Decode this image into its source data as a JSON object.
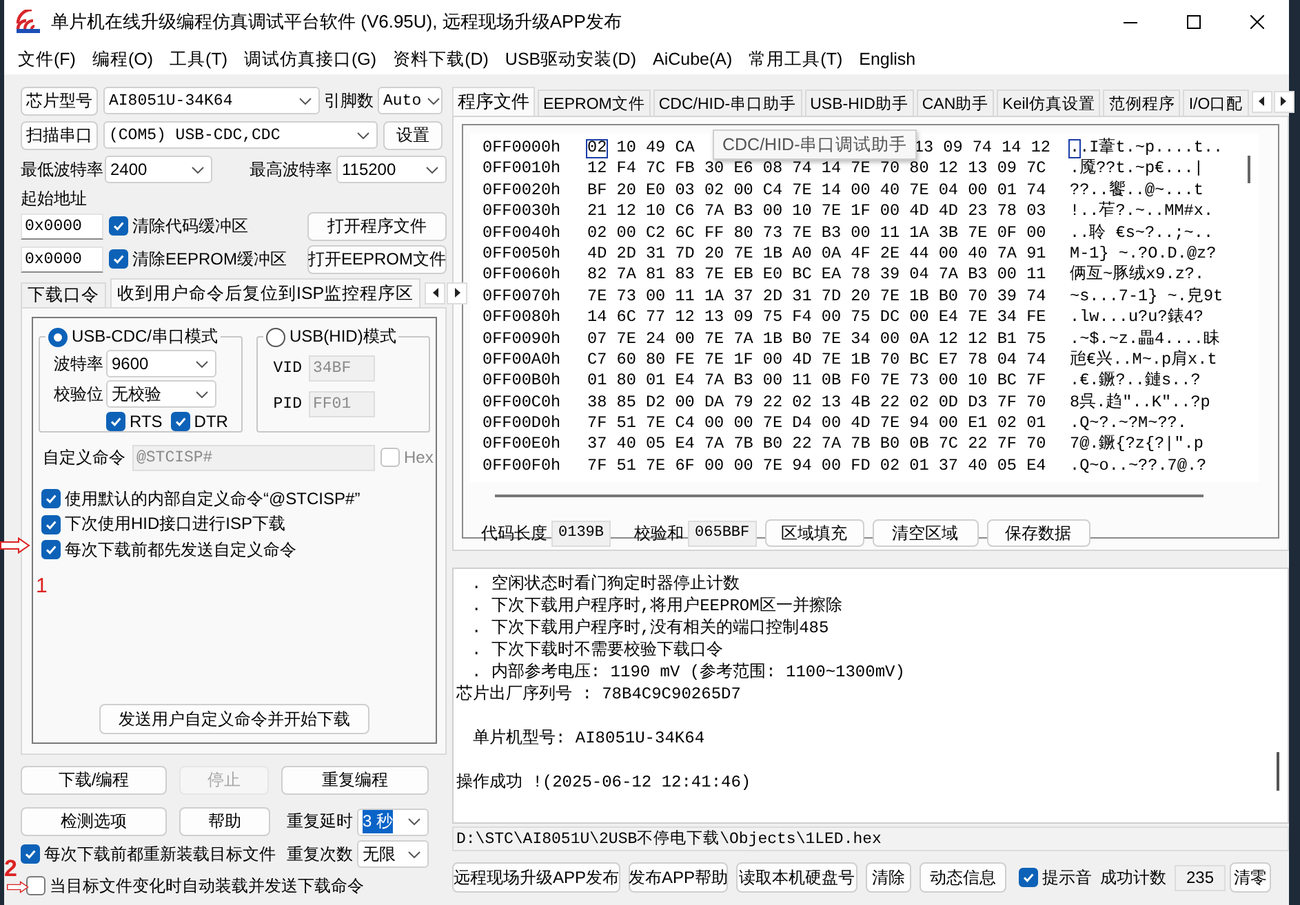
{
  "window": {
    "title": "单片机在线升级编程仿真调试平台软件 (V6.95U), 远程现场升级APP发布"
  },
  "menu": [
    "文件(F)",
    "编程(O)",
    "工具(T)",
    "调试仿真接口(G)",
    "资料下载(D)",
    "USB驱动安装(D)",
    "AiCube(A)",
    "常用工具(T)",
    "English"
  ],
  "chip": {
    "button": "芯片型号",
    "value": "AI8051U-34K64",
    "pins_label": "引脚数",
    "pins": "Auto"
  },
  "port": {
    "button": "扫描串口",
    "value": "(COM5) USB-CDC,CDC",
    "settings": "设置"
  },
  "baud": {
    "min_label": "最低波特率",
    "min": "2400",
    "max_label": "最高波特率",
    "max": "115200"
  },
  "addresses": {
    "label": "起始地址",
    "code": "0x0000",
    "clear_code": {
      "label": "清除代码缓冲区",
      "checked": true
    },
    "open_program": "打开程序文件",
    "eeprom": "0x0000",
    "clear_eeprom": {
      "label": "清除EEPROM缓冲区",
      "checked": true
    },
    "open_eeprom": "打开EEPROM文件"
  },
  "left_tabs": [
    {
      "label": "下载口令",
      "selected": false
    },
    {
      "label": "收到用户命令后复位到ISP监控程序区",
      "selected": true
    }
  ],
  "mode_cdc": {
    "label": "USB-CDC/串口模式",
    "selected": true,
    "baud_label": "波特率",
    "baud": "9600",
    "parity_label": "校验位",
    "parity": "无校验",
    "rts": {
      "label": "RTS",
      "checked": true
    },
    "dtr": {
      "label": "DTR",
      "checked": true
    }
  },
  "mode_hid": {
    "label": "USB(HID)模式",
    "selected": false,
    "vid_label": "VID",
    "vid": "34BF",
    "pid_label": "PID",
    "pid": "FF01"
  },
  "custom_command": {
    "label": "自定义命令",
    "value": "@STCISP#",
    "disabled": true,
    "hex": {
      "label": "Hex",
      "checked": false
    }
  },
  "options": [
    {
      "label": "使用默认的内部自定义命令“@STCISP#”",
      "checked": true
    },
    {
      "label": "下次使用HID接口进行ISP下载",
      "checked": true
    },
    {
      "label": "每次下载前都先发送自定义命令",
      "checked": true
    }
  ],
  "send_button": "发送用户自定义命令并开始下载",
  "actions": {
    "download": "下载/编程",
    "stop": {
      "label": "停止",
      "disabled": true
    },
    "repeat": "重复编程",
    "check": "检测选项",
    "help": "帮助",
    "delay_label": "重复延时",
    "delay": {
      "value": "3 秒",
      "focused": true
    },
    "count_label": "重复次数",
    "count": "无限"
  },
  "reload": [
    {
      "label": "每次下载前都重新装载目标文件",
      "checked": true
    },
    {
      "label": "当目标文件变化时自动装载并发送下载命令",
      "checked": false
    }
  ],
  "annotations": [
    {
      "label": "1"
    },
    {
      "label": "2"
    }
  ],
  "right_tabs": [
    {
      "label": "程序文件",
      "selected": true
    },
    {
      "label": "EEPROM文件",
      "selected": false
    },
    {
      "label": "CDC/HID-串口助手",
      "selected": false
    },
    {
      "label": "USB-HID助手",
      "selected": false
    },
    {
      "label": "CAN助手",
      "selected": false
    },
    {
      "label": "Keil仿真设置",
      "selected": false
    },
    {
      "label": "范例程序",
      "selected": false
    },
    {
      "label": "I/O口配",
      "selected": false
    }
  ],
  "hex": {
    "tooltip": "CDC/HID-串口调试助手",
    "rows": [
      {
        "address": "0FF0000h",
        "bytes": "02 10 49 CA",
        "bytes_end": "13 09 74 14 12",
        "ascii": "..I葦t.~p....t..",
        "cursor": true
      },
      {
        "address": "0FF0010h",
        "bytes": "12 F4 7C FB 30 E6 08 74 14 7E 70 80 12 13 09 7C",
        "ascii": ".魇??t.~p€...|",
        "cursor": false
      },
      {
        "address": "0FF0020h",
        "bytes": "BF 20 E0 03 02 00 C4 7E 14 00 40 7E 04 00 01 74",
        "ascii": "??..饗..@~...t",
        "cursor": false
      },
      {
        "address": "0FF0030h",
        "bytes": "21 12 10 C6 7A B3 00 10 7E 1F 00 4D 4D 23 78 03",
        "ascii": "!..苲?.~..MM#x.",
        "cursor": false
      },
      {
        "address": "0FF0040h",
        "bytes": "02 00 C2 6C FF 80 73 7E B3 00 11 1A 3B 7E 0F 00",
        "ascii": "..聆 €s~?..;~..",
        "cursor": false
      },
      {
        "address": "0FF0050h",
        "bytes": "4D 2D 31 7D 20 7E 1B A0 0A 4F 2E 44 00 40 7A 91",
        "ascii": "M-1} ~.?O.D.@z?",
        "cursor": false
      },
      {
        "address": "0FF0060h",
        "bytes": "82 7A 81 83 7E EB E0 BC EA 78 39 04 7A B3 00 11",
        "ascii": "俩亙~豚绒x9.z?.",
        "cursor": false
      },
      {
        "address": "0FF0070h",
        "bytes": "7E 73 00 11 1A 37 2D 31 7D 20 7E 1B B0 70 39 74",
        "ascii": "~s...7-1} ~.皃9t",
        "cursor": false
      },
      {
        "address": "0FF0080h",
        "bytes": "14 6C 77 12 13 09 75 F4 00 75 DC 00 E4 7E 34 FE",
        "ascii": ".lw...u?u?錶4?",
        "cursor": false
      },
      {
        "address": "0FF0090h",
        "bytes": "07 7E 24 00 7E 7A 1B B0 7E 34 00 0A 12 12 B1 75",
        "ascii": ".~$.~z.畾4....眛",
        "cursor": false
      },
      {
        "address": "0FF00A0h",
        "bytes": "C7 60 80 FE 7E 1F 00 4D 7E 1B 70 BC E7 78 04 74",
        "ascii": "兘€兴..M~.p肩x.t",
        "cursor": false
      },
      {
        "address": "0FF00B0h",
        "bytes": "01 80 01 E4 7A B3 00 11 0B F0 7E 73 00 10 BC 7F",
        "ascii": ".€.鐝?..鏈s..?",
        "cursor": false
      },
      {
        "address": "0FF00C0h",
        "bytes": "38 85 D2 00 DA 79 22 02 13 4B 22 02 0D D3 7F 70",
        "ascii": "8呉.趋\"..K\"..?p",
        "cursor": false
      },
      {
        "address": "0FF00D0h",
        "bytes": "7F 51 7E C4 00 00 7E D4 00 4D 7E 94 00 E1 02 01",
        "ascii": ".Q~?.~?M~??.",
        "cursor": false
      },
      {
        "address": "0FF00E0h",
        "bytes": "37 40 05 E4 7A 7B B0 22 7A 7B B0 0B 7C 22 7F 70",
        "ascii": "7@.鐝{?z{?|\".p",
        "cursor": false
      },
      {
        "address": "0FF00F0h",
        "bytes": "7F 51 7E 6F 00 00 7E 94 00 FD 02 01 37 40 05 E4",
        "ascii": ".Q~o..~??.7@.?",
        "cursor": false
      }
    ]
  },
  "code_info": {
    "length_label": "代码长度",
    "length": "0139B",
    "checksum_label": "校验和",
    "checksum": "065BBF",
    "buttons": [
      "区域填充",
      "清空区域",
      "保存数据"
    ]
  },
  "log": [
    {
      "kind": "bullet",
      "text": ". 空闲状态时看门狗定时器停止计数"
    },
    {
      "kind": "bullet",
      "text": ". 下次下载用户程序时,将用户EEPROM区一并擦除"
    },
    {
      "kind": "bullet",
      "text": ". 下次下载用户程序时,没有相关的端口控制485"
    },
    {
      "kind": "bullet",
      "text": ". 下次下载时不需要校验下载口令"
    },
    {
      "kind": "bullet",
      "text": ". 内部参考电压: 1190 mV (参考范围: 1100~1300mV)"
    },
    {
      "kind": "plain",
      "text": "芯片出厂序列号 : 78B4C9C90265D7"
    },
    {
      "kind": "indented",
      "text": "单片机型号: AI8051U-34K64"
    },
    {
      "kind": "result",
      "text": "操作成功 !(2025-06-12 12:41:46)"
    }
  ],
  "file_path": "D:\\STC\\AI8051U\\2USB不停电下载\\Objects\\1LED.hex",
  "bottom": {
    "buttons": [
      "远程现场升级APP发布",
      "发布APP帮助",
      "读取本机硬盘号",
      "清除",
      "动态信息"
    ],
    "sound": {
      "label": "提示音",
      "checked": true
    },
    "count_label": "成功计数",
    "count": "235",
    "reset": "清零"
  }
}
